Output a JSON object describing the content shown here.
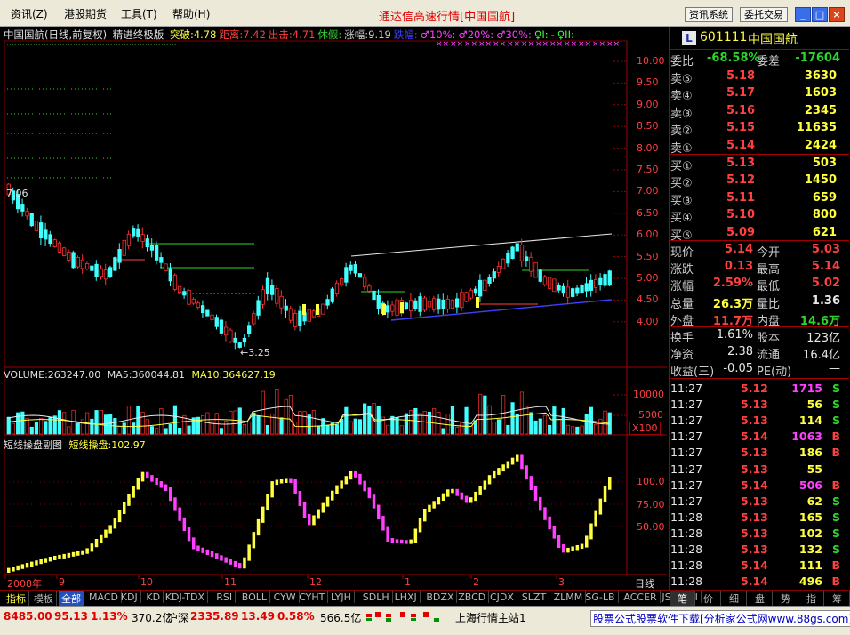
{
  "menu": {
    "items": [
      "资讯(Z)",
      "港股期货",
      "工具(T)",
      "帮助(H)"
    ],
    "title": "通达信高速行情[中国国航]",
    "btn_news": "资讯系统",
    "btn_trade": "委托交易"
  },
  "chart": {
    "header": {
      "name": "中国国航(日线,前复权)",
      "indicator": "精进终极版",
      "tags": [
        {
          "text": "突破:4.78",
          "color": "#ffff40"
        },
        {
          "text": "距离:7.42",
          "color": "#ff4040"
        },
        {
          "text": "出击:4.71",
          "color": "#ff4040"
        },
        {
          "text": "休假:",
          "color": "#2bd52b"
        },
        {
          "text": "涨幅:9.19",
          "color": "#cccccc"
        },
        {
          "text": "跌幅:",
          "color": "#4040ff"
        },
        {
          "text": "♂10%:",
          "color": "#ff40ff"
        },
        {
          "text": "♂20%:",
          "color": "#ff40ff"
        },
        {
          "text": "♂30%:",
          "color": "#ff40ff"
        },
        {
          "text": "♀I:",
          "color": "#40ff40"
        },
        {
          "text": "-",
          "color": "#cccccc"
        },
        {
          "text": "♀II:",
          "color": "#40ff40"
        }
      ]
    },
    "price_axis": [
      "10.00",
      "9.50",
      "9.00",
      "8.50",
      "8.00",
      "7.50",
      "7.00",
      "6.50",
      "6.00",
      "5.50",
      "5.00",
      "4.50",
      "4.00"
    ],
    "annotations": {
      "high": "7.06",
      "low": "←3.25"
    },
    "volume": {
      "label": "VOLUME:263247.00",
      "ma5": "MA5:360044.81",
      "ma10": "MA10:364627.19",
      "axis": [
        "10000",
        "5000"
      ],
      "unit": "X100"
    },
    "osc": {
      "label": "短线操盘副图",
      "value": "短线操盘:102.97",
      "axis": [
        "100.0",
        "75.00",
        "50.00"
      ]
    },
    "x_axis": [
      "2008年",
      "9",
      "10",
      "11",
      "12",
      "1",
      "2",
      "3"
    ],
    "period": "日线"
  },
  "quote": {
    "badge": "L",
    "code": "601111",
    "name": "中国国航",
    "weibi_label": "委比",
    "weibi": "-68.58%",
    "weicha_label": "委差",
    "weicha": "-17604",
    "asks": [
      {
        "label": "卖⑤",
        "price": "5.18",
        "vol": "3630"
      },
      {
        "label": "卖④",
        "price": "5.17",
        "vol": "1603"
      },
      {
        "label": "卖③",
        "price": "5.16",
        "vol": "2345"
      },
      {
        "label": "卖②",
        "price": "5.15",
        "vol": "11635"
      },
      {
        "label": "卖①",
        "price": "5.14",
        "vol": "2424"
      }
    ],
    "bids": [
      {
        "label": "买①",
        "price": "5.13",
        "vol": "503"
      },
      {
        "label": "买②",
        "price": "5.12",
        "vol": "1450"
      },
      {
        "label": "买③",
        "price": "5.11",
        "vol": "659"
      },
      {
        "label": "买④",
        "price": "5.10",
        "vol": "800"
      },
      {
        "label": "买⑤",
        "price": "5.09",
        "vol": "621"
      }
    ],
    "stats": [
      {
        "l1": "现价",
        "v1": "5.14",
        "c1": "#ff4040",
        "l2": "今开",
        "v2": "5.03",
        "c2": "#ff4040"
      },
      {
        "l1": "涨跌",
        "v1": "0.13",
        "c1": "#ff4040",
        "l2": "最高",
        "v2": "5.14",
        "c2": "#ff4040"
      },
      {
        "l1": "涨幅",
        "v1": "2.59%",
        "c1": "#ff4040",
        "l2": "最低",
        "v2": "5.02",
        "c2": "#ff4040"
      },
      {
        "l1": "总量",
        "v1": "26.3万",
        "c1": "#ffff40",
        "l2": "量比",
        "v2": "1.36",
        "c2": "#e8e8e8"
      },
      {
        "l1": "外盘",
        "v1": "11.7万",
        "c1": "#ff4040",
        "l2": "内盘",
        "v2": "14.6万",
        "c2": "#2bd52b"
      }
    ],
    "fund": [
      {
        "l1": "换手",
        "v1": "1.61%",
        "l2": "股本",
        "v2": "123亿"
      },
      {
        "l1": "净资",
        "v1": "2.38",
        "l2": "流通",
        "v2": "16.4亿"
      },
      {
        "l1": "收益(三)",
        "v1": "-0.05",
        "l2": "PE(动)",
        "v2": "—"
      }
    ],
    "ticks": [
      {
        "time": "11:27",
        "price": "5.12",
        "vol": "1715",
        "side": "S",
        "vc": "#ff40ff"
      },
      {
        "time": "11:27",
        "price": "5.13",
        "vol": "56",
        "side": "S",
        "vc": "#ffff40"
      },
      {
        "time": "11:27",
        "price": "5.13",
        "vol": "114",
        "side": "S",
        "vc": "#ffff40"
      },
      {
        "time": "11:27",
        "price": "5.14",
        "vol": "1063",
        "side": "B",
        "vc": "#ff40ff"
      },
      {
        "time": "11:27",
        "price": "5.13",
        "vol": "186",
        "side": "B",
        "vc": "#ffff40"
      },
      {
        "time": "11:27",
        "price": "5.13",
        "vol": "55",
        "side": "",
        "vc": "#ffff40"
      },
      {
        "time": "11:27",
        "price": "5.14",
        "vol": "506",
        "side": "B",
        "vc": "#ff40ff"
      },
      {
        "time": "11:27",
        "price": "5.13",
        "vol": "62",
        "side": "S",
        "vc": "#ffff40"
      },
      {
        "time": "11:28",
        "price": "5.13",
        "vol": "165",
        "side": "S",
        "vc": "#ffff40"
      },
      {
        "time": "11:28",
        "price": "5.13",
        "vol": "102",
        "side": "S",
        "vc": "#ffff40"
      },
      {
        "time": "11:28",
        "price": "5.13",
        "vol": "132",
        "side": "S",
        "vc": "#ffff40"
      },
      {
        "time": "11:28",
        "price": "5.14",
        "vol": "111",
        "side": "B",
        "vc": "#ffff40"
      },
      {
        "time": "11:28",
        "price": "5.14",
        "vol": "496",
        "side": "B",
        "vc": "#ffff40"
      }
    ],
    "tabs": [
      "笔",
      "价",
      "细",
      "盘",
      "势",
      "指",
      "筹"
    ]
  },
  "toolbar": {
    "tabs": [
      "指标",
      "模板",
      "全部",
      "MACD",
      "KDJ",
      "KD",
      "KDJ-TDX",
      "RSI",
      "BOLL",
      "CYW",
      "CYHT",
      "LYJH",
      "SDLH",
      "LHXJ",
      "BDZX",
      "ZBCD",
      "CJDX",
      "SLZT",
      "ZLMM",
      "SG-LB",
      "ACCER",
      "JS",
      "MFI"
    ]
  },
  "status": {
    "sh_index": "8485.00",
    "sh_change": "95.13",
    "sh_pct": "1.13%",
    "sh_amount": "370.2亿",
    "hs_label": "沪深",
    "hs_index": "2335.89",
    "hs_change": "13.49",
    "hs_pct": "0.58%",
    "hs_amount": "566.5亿",
    "server": "上海行情主站1",
    "ad": "股票公式股票软件下载[分析家公式网www.88gs.com]"
  }
}
